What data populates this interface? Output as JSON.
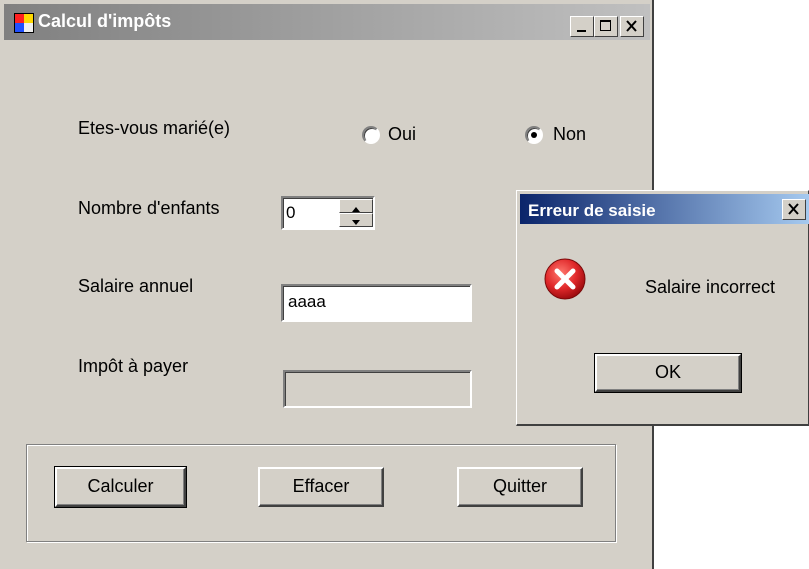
{
  "main_window": {
    "title": "Calcul d'impôts",
    "labels": {
      "married": "Etes-vous marié(e)",
      "children": "Nombre d'enfants",
      "salary": "Salaire annuel",
      "tax": "Impôt à payer"
    },
    "radios": {
      "yes_label": "Oui",
      "no_label": "Non",
      "selected": "Non"
    },
    "children_value": "0",
    "salary_value": "aaaa",
    "tax_value": "",
    "buttons": {
      "calculate": "Calculer",
      "clear": "Effacer",
      "quit": "Quitter"
    }
  },
  "dialog": {
    "title": "Erreur de saisie",
    "message": "Salaire incorrect",
    "ok_label": "OK",
    "icon": "error-icon"
  },
  "colors": {
    "window_bg": "#d4d0c8",
    "inactive_title": "#808080",
    "active_title": "#0a246a",
    "error_red": "#e0282a"
  }
}
